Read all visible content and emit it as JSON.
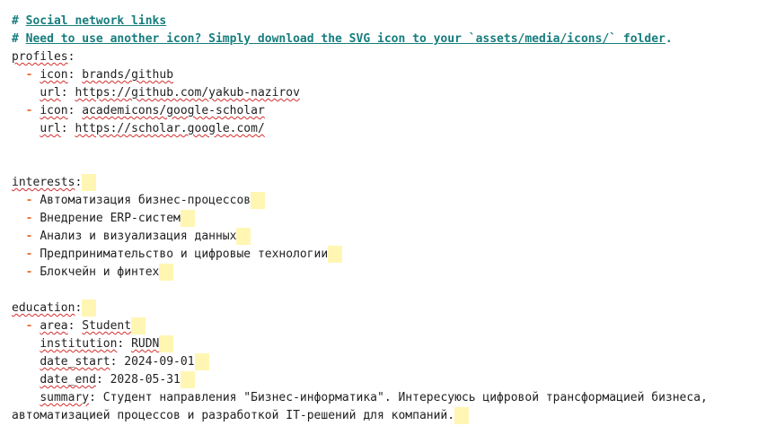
{
  "comments": {
    "line1": "# Social network links",
    "line2": "# Need to use another icon? Simply download the SVG icon to your `assets/media/icons/` folder."
  },
  "profiles": {
    "key": "profiles",
    "items": [
      {
        "icon_key": "icon",
        "icon": "brands/github",
        "url_key": "url",
        "url": "https://github.com/yakub-nazirov"
      },
      {
        "icon_key": "icon",
        "icon": "academicons/google-scholar",
        "url_key": "url",
        "url": "https://scholar.google.com/"
      }
    ]
  },
  "interests": {
    "key": "interests",
    "items": [
      "Автоматизация бизнес-процессов",
      "Внедрение ERP-систем",
      "Анализ и визуализация данных",
      "Предпринимательство и цифровые технологии",
      "Блокчейн и финтех"
    ]
  },
  "education": {
    "key": "education",
    "area_key": "area",
    "area": "Student",
    "institution_key": "institution",
    "institution": "RUDN",
    "date_start_key": "date_start",
    "date_start": "2024-09-01",
    "date_end_key": "date_end",
    "date_end": "2028-05-31",
    "summary_key": "summary",
    "summary_line1": "Студент направления \"Бизнес-информатика\". Интересуюсь цифровой трансформацией бизнеса,",
    "summary_line2": "автоматизацией процессов и разработкой IT-решений для компаний."
  },
  "colors": {
    "comment": "#177d7d",
    "dash": "#e8743b",
    "highlight": "#fff6b3",
    "spellcheck": "#d32f2f"
  }
}
